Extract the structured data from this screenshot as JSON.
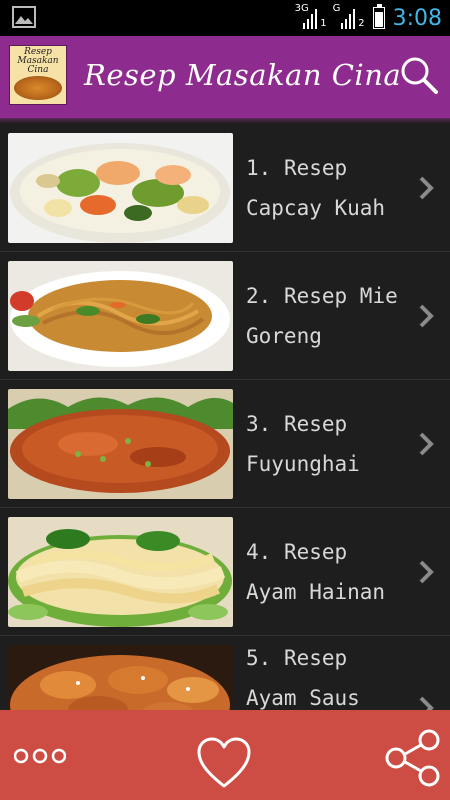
{
  "status_bar": {
    "time": "3:08",
    "signal1_tag": "3G",
    "signal1_sub": "1",
    "signal2_tag": "G",
    "signal2_sub": "2",
    "battery_level": 0.75,
    "image_icon": "image-icon"
  },
  "header": {
    "title": "Resep Masakan Cina",
    "logo_text": "Resep Masakan Cina",
    "search_icon": "search-icon",
    "background": "#8e2b8e"
  },
  "recipes": [
    {
      "number": "1.",
      "line1": "Resep",
      "line2": "Capcay Kuah"
    },
    {
      "number": "2.",
      "line1": "Resep Mie",
      "line2": "Goreng"
    },
    {
      "number": "3.",
      "line1": "Resep",
      "line2": "Fuyunghai"
    },
    {
      "number": "4.",
      "line1": "Resep",
      "line2": "Ayam Hainan"
    },
    {
      "number": "5.",
      "line1": "Resep",
      "line2": "Ayam Saus"
    }
  ],
  "bottom_bar": {
    "background": "#cd4d44",
    "more_icon": "more-icon",
    "favorite_icon": "heart-icon",
    "share_icon": "share-icon"
  }
}
